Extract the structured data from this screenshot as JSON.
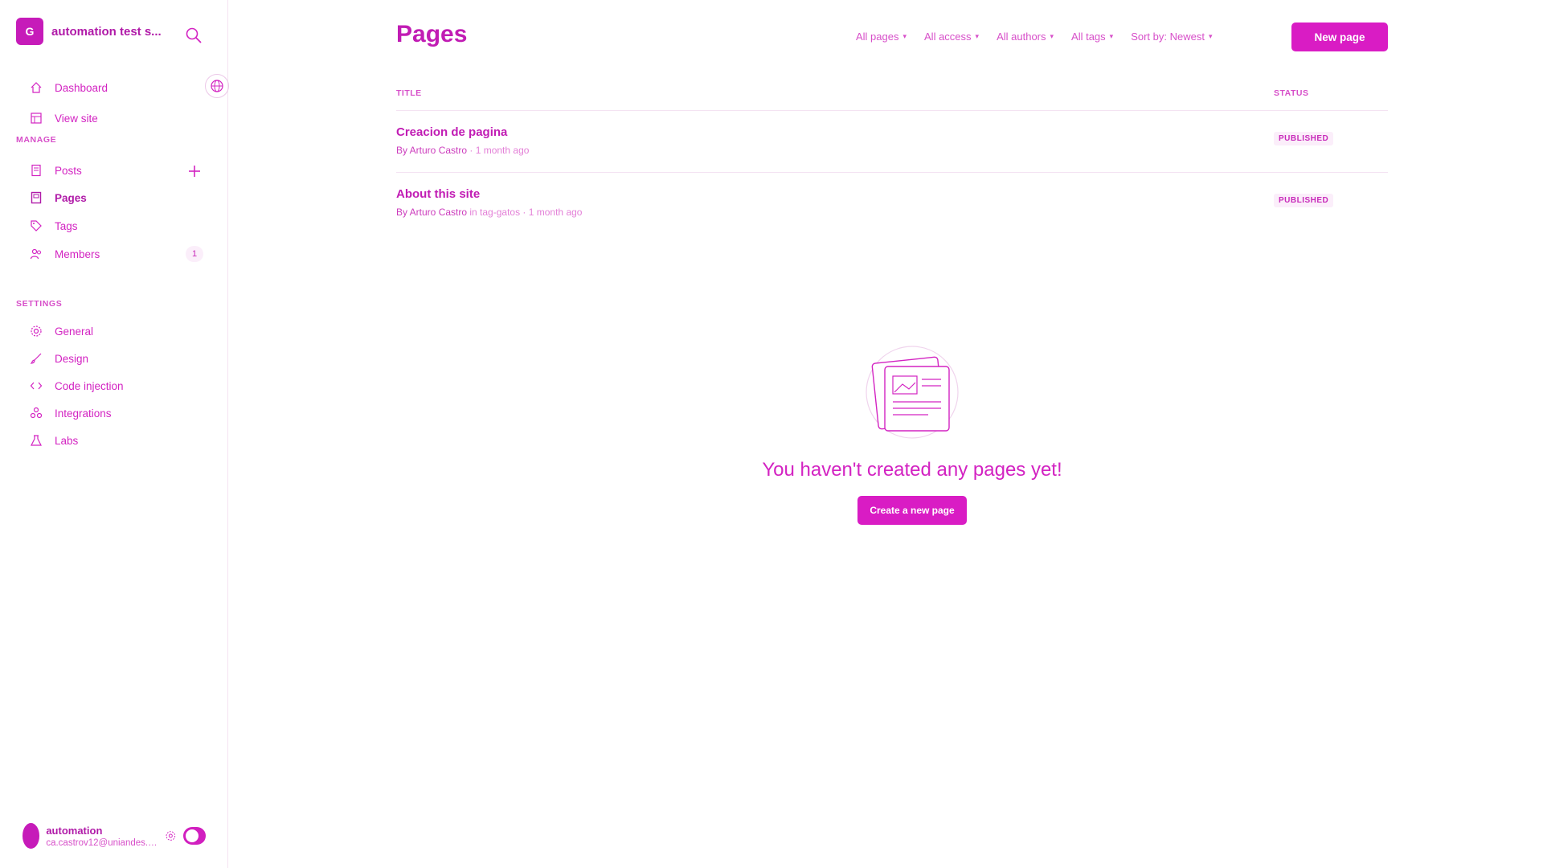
{
  "sidebar": {
    "site_name": "automation test s...",
    "logo_text": "Ghost",
    "nav_top": [
      {
        "label": "Dashboard",
        "icon": "home-icon"
      },
      {
        "label": "View site",
        "icon": "layout-icon"
      }
    ],
    "manage_title": "MANAGE",
    "manage_items": [
      {
        "label": "Posts",
        "icon": "posts-icon"
      },
      {
        "label": "Pages",
        "icon": "pages-icon"
      },
      {
        "label": "Tags",
        "icon": "tag-icon"
      },
      {
        "label": "Members",
        "icon": "members-icon"
      }
    ],
    "members_count": "1",
    "settings_title": "SETTINGS",
    "settings_items": [
      {
        "label": "General",
        "icon": "gear-icon"
      },
      {
        "label": "Design",
        "icon": "brush-icon"
      },
      {
        "label": "Code injection",
        "icon": "code-icon"
      },
      {
        "label": "Integrations",
        "icon": "integrations-icon"
      },
      {
        "label": "Labs",
        "icon": "flask-icon"
      }
    ],
    "user": {
      "name": "automation",
      "email": "ca.castrov12@uniandes.ed..."
    }
  },
  "main": {
    "title": "Pages",
    "filters": [
      "All pages",
      "All access",
      "All authors",
      "All tags",
      "Sort by: Newest"
    ],
    "new_button": "New page",
    "columns": {
      "title": "TITLE",
      "status": "STATUS"
    },
    "rows": [
      {
        "title": "Creacion de pagina",
        "author": "By Arturo Castro",
        "meta": "· 1 month ago",
        "status": "PUBLISHED"
      },
      {
        "title": "About this site",
        "author": "By Arturo Castro",
        "meta": "in tag-gatos · 1 month ago",
        "status": "PUBLISHED"
      }
    ],
    "empty_text": "You haven't created any pages yet!",
    "empty_button": "Create a new page"
  },
  "colors": {
    "accent": "#d91cc4",
    "text": "#c11cb4"
  }
}
